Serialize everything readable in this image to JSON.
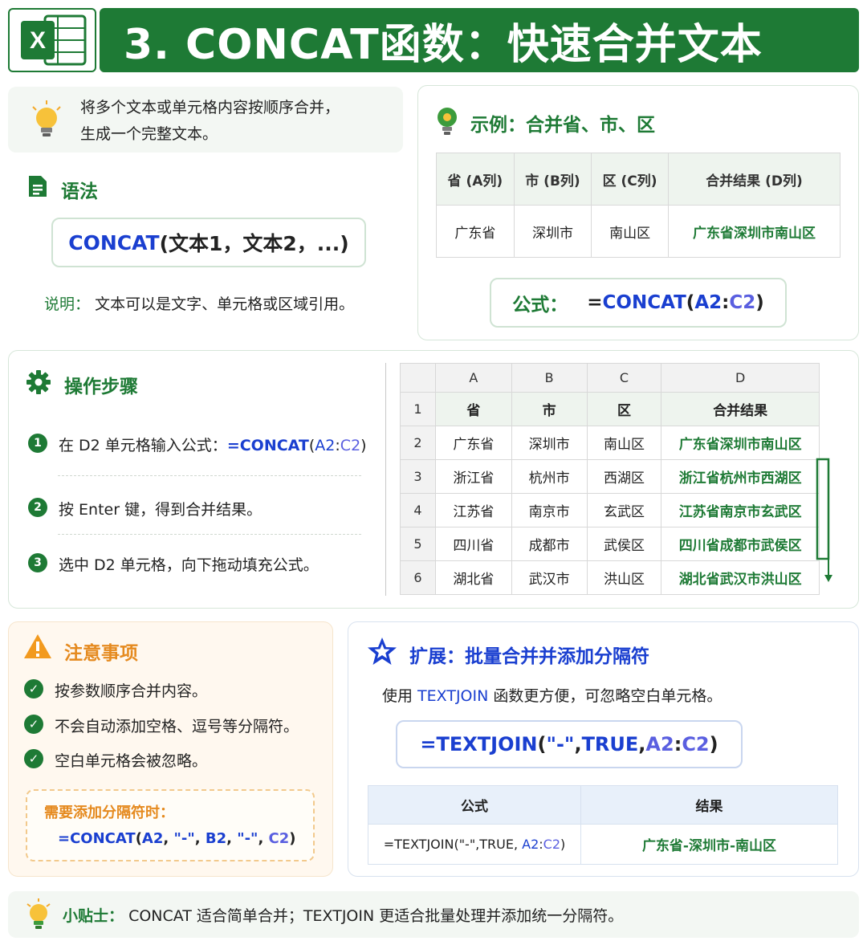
{
  "header": {
    "logo_letter": "X",
    "title": "3. CONCAT函数：快速合并文本"
  },
  "intro": {
    "line1": "将多个文本或单元格内容按顺序合并，",
    "line2": "生成一个完整文本。"
  },
  "syntax": {
    "heading": "语法",
    "func": "CONCAT",
    "args": "(文本1，文本2，...)",
    "note_label": "说明：",
    "note_text": "文本可以是文字、单元格或区域引用。"
  },
  "example": {
    "heading": "示例：合并省、市、区",
    "headers": [
      "省 (A列)",
      "市 (B列)",
      "区 (C列)",
      "合并结果 (D列)"
    ],
    "row": [
      "广东省",
      "深圳市",
      "南山区",
      "广东省深圳市南山区"
    ],
    "formula_label": "公式：",
    "formula_eq": "=",
    "formula_func": "CONCAT",
    "formula_open": "(",
    "formula_a2": "A2",
    "formula_colon": ":",
    "formula_c2": "C2",
    "formula_close": ")"
  },
  "steps": {
    "heading": "操作步骤",
    "items": [
      {
        "num": "1",
        "text": "在 D2 单元格输入公式：",
        "formula_func": "=CONCAT",
        "formula_open": "(",
        "formula_a2": "A2",
        "formula_colon": ":",
        "formula_c2": "C2",
        "formula_close": ")"
      },
      {
        "num": "2",
        "text": "按 Enter 键，得到合并结果。"
      },
      {
        "num": "3",
        "text": "选中 D2 单元格，向下拖动填充公式。"
      }
    ]
  },
  "sheet": {
    "col_letters": [
      "A",
      "B",
      "C",
      "D"
    ],
    "rows": [
      {
        "n": "1",
        "cells": [
          "省",
          "市",
          "区",
          "合并结果"
        ]
      },
      {
        "n": "2",
        "cells": [
          "广东省",
          "深圳市",
          "南山区",
          "广东省深圳市南山区"
        ]
      },
      {
        "n": "3",
        "cells": [
          "浙江省",
          "杭州市",
          "西湖区",
          "浙江省杭州市西湖区"
        ]
      },
      {
        "n": "4",
        "cells": [
          "江苏省",
          "南京市",
          "玄武区",
          "江苏省南京市玄武区"
        ]
      },
      {
        "n": "5",
        "cells": [
          "四川省",
          "成都市",
          "武侯区",
          "四川省成都市武侯区"
        ]
      },
      {
        "n": "6",
        "cells": [
          "湖北省",
          "武汉市",
          "洪山区",
          "湖北省武汉市洪山区"
        ]
      }
    ]
  },
  "notes": {
    "heading": "注意事项",
    "items": [
      "按参数顺序合并内容。",
      "不会自动添加空格、逗号等分隔符。",
      "空白单元格会被忽略。"
    ],
    "sub_heading": "需要添加分隔符时：",
    "sub_f_func": "=CONCAT",
    "sub_f_open": "(",
    "sub_f_a2": "A2",
    "sub_f_sep1": "\"-\"",
    "sub_f_b2": "B2",
    "sub_f_sep2": "\"-\"",
    "sub_f_c2": "C2",
    "sub_f_comma": ", ",
    "sub_f_close": ")"
  },
  "extension": {
    "heading": "扩展：批量合并并添加分隔符",
    "desc_pre": "使用 ",
    "desc_func": "TEXTJOIN",
    "desc_post": " 函数更方便，可忽略空白单元格。",
    "f_func": "=TEXTJOIN",
    "f_open": "(",
    "f_sep": "\"-\"",
    "f_comma": ", ",
    "f_true": "TRUE",
    "f_a2": "A2",
    "f_colon": ":",
    "f_c2": "C2",
    "f_close": ")",
    "table_headers": [
      "公式",
      "结果"
    ],
    "table_formula_prefix": "=TEXTJOIN(\"-\",TRUE, ",
    "table_formula_a2": "A2",
    "table_formula_colon": ":",
    "table_formula_c2": "C2",
    "table_formula_close": ")",
    "table_result": "广东省-深圳市-南山区"
  },
  "tip": {
    "label": "小贴士：",
    "text": "CONCAT 适合简单合并；TEXTJOIN 更适合批量处理并添加统一分隔符。"
  },
  "colors": {
    "brand_green": "#1e7a35",
    "formula_blue": "#1a3fd0",
    "ref_c2": "#5a5fe0",
    "warn_orange": "#e58a1f"
  }
}
